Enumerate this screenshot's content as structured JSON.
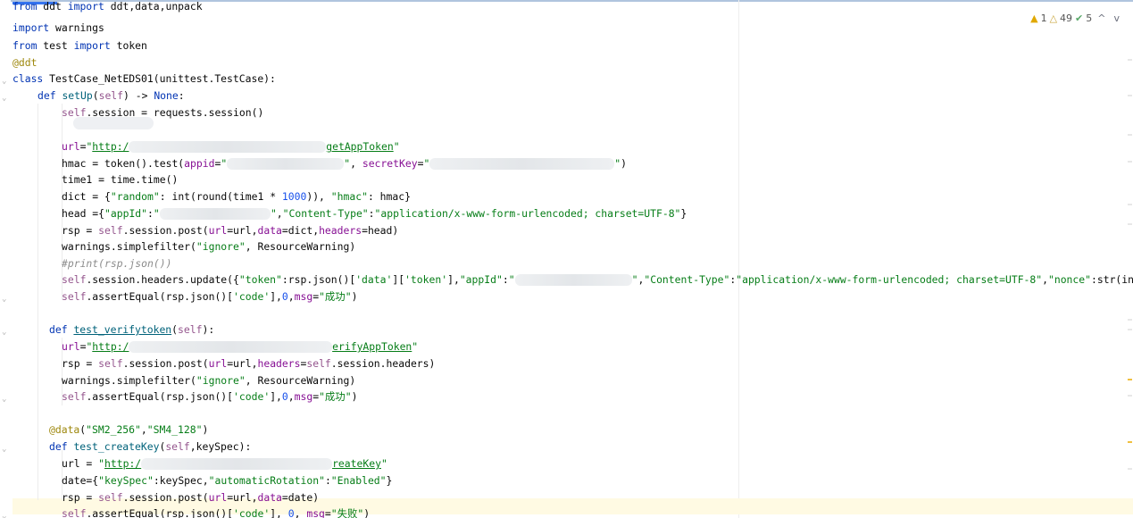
{
  "editor": {
    "inspections": {
      "errors": "1",
      "warnings": "49",
      "typos": "5",
      "prev_label": "^",
      "next_label": "v"
    },
    "colors": {
      "keyword": "#0033b3",
      "string": "#067d17",
      "decorator": "#9e880d",
      "number": "#1750eb",
      "comment": "#8c8c8c",
      "current_line": "#fffae3"
    },
    "lines": [
      {
        "text": "from ddt import ddt,data,unpack"
      },
      {
        "text": "import warnings"
      },
      {
        "text": "from test import token"
      },
      {
        "text": "@ddt"
      },
      {
        "text": "class TestCase_NetEDS01(unittest.TestCase):"
      },
      {
        "text": "def setUp(self) -> None:"
      },
      {
        "text": "self.session = requests.session()"
      },
      {
        "text": ""
      },
      {
        "text": "url=\"http:/                                getAppToken\""
      },
      {
        "text": "hmac = token().test(appid=\"                   \", secretKey=\"                              \")"
      },
      {
        "text": "time1 = time.time()"
      },
      {
        "text": "dict = {\"random\": int(round(time1 * 1000)), \"hmac\": hmac}"
      },
      {
        "text": "head ={\"appId\":\"                  \",\"Content-Type\":\"application/x-www-form-urlencoded; charset=UTF-8\"}"
      },
      {
        "text": "rsp = self.session.post(url=url,data=dict,headers=head)"
      },
      {
        "text": "warnings.simplefilter(\"ignore\", ResourceWarning)"
      },
      {
        "text": "#print(rsp.json())"
      },
      {
        "text": "self.session.headers.update({\"token\":rsp.json()['data']['token'],\"appId\":\"                   \",\"Content-Type\":\"application/x-www-form-urlencoded; charset=UTF-8\",\"nonce\":str(int(r"
      },
      {
        "text": "self.assertEqual(rsp.json()['code'],0,msg=\"成功\")"
      },
      {
        "text": ""
      },
      {
        "text": "def test_verifytoken(self):"
      },
      {
        "text": "url=\"http:/                                 erifyAppToken\""
      },
      {
        "text": "rsp = self.session.post(url=url,headers=self.session.headers)"
      },
      {
        "text": "warnings.simplefilter(\"ignore\", ResourceWarning)"
      },
      {
        "text": "self.assertEqual(rsp.json()['code'],0,msg=\"成功\")"
      },
      {
        "text": ""
      },
      {
        "text": "@data(\"SM2_256\",\"SM4_128\")"
      },
      {
        "text": "def test_createKey(self,keySpec):"
      },
      {
        "text": "url = \"http:/                               reateKey\""
      },
      {
        "text": "date={\"keySpec\":keySpec,\"automaticRotation\":\"Enabled\"}"
      },
      {
        "text": "rsp = self.session.post(url=url,data=date)"
      },
      {
        "text": "self.assertEqual(rsp.json()['code'], 0, msg=\"失败\")"
      }
    ]
  }
}
